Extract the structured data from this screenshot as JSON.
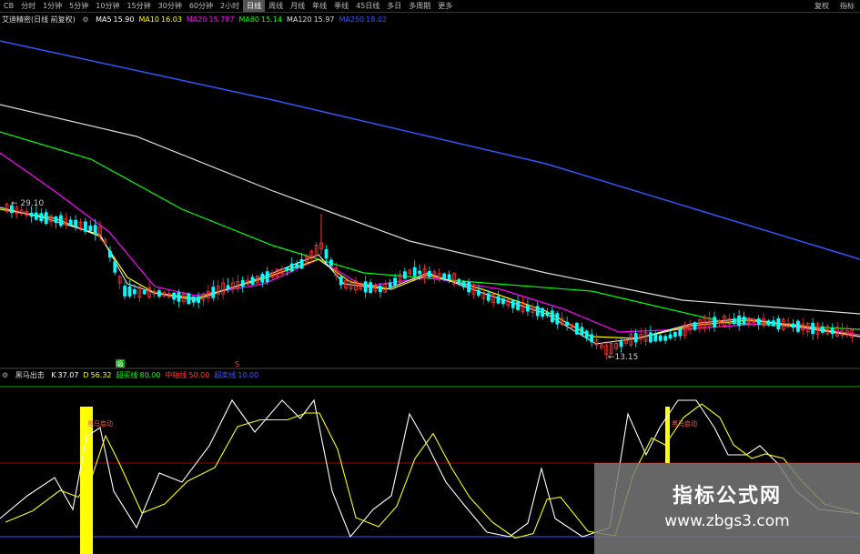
{
  "toolbar": {
    "items": [
      "CB",
      "分时",
      "1分钟",
      "5分钟",
      "10分钟",
      "15分钟",
      "30分钟",
      "60分钟",
      "2小时",
      "日线",
      "周线",
      "月线",
      "年线",
      "季线",
      "45日线",
      "多日",
      "多周期",
      "更多"
    ],
    "active_index": 9,
    "right_items": [
      "复权",
      "指标"
    ]
  },
  "main_legend": {
    "title": "艾迪精密(日线 前复权)",
    "items": [
      {
        "label": "MA5",
        "value": "15.90",
        "color": "#ffffff"
      },
      {
        "label": "MA10",
        "value": "16.03",
        "color": "#ffff00"
      },
      {
        "label": "MA20",
        "value": "15.787",
        "color": "#ff00ff"
      },
      {
        "label": "MA60",
        "value": "15.14",
        "color": "#00ff00"
      },
      {
        "label": "MA120",
        "value": "15.97",
        "color": "#dddddd"
      },
      {
        "label": "MA250",
        "value": "18.02",
        "color": "#3355ff"
      }
    ]
  },
  "price_labels": {
    "high": "29.10",
    "low": "13.15"
  },
  "signals": {
    "buy": "吸",
    "sell": "S"
  },
  "indicator_legend": {
    "title": "黑马出击",
    "items": [
      {
        "label": "K",
        "value": "37.07",
        "color": "#ffffff"
      },
      {
        "label": "D",
        "value": "56.32",
        "color": "#ffff00"
      },
      {
        "label": "超买线",
        "value": "80.00",
        "color": "#00ff00"
      },
      {
        "label": "中轴线",
        "value": "50.00",
        "color": "#ff3333"
      },
      {
        "label": "超卖线",
        "value": "10.00",
        "color": "#3355ff"
      }
    ]
  },
  "indicator_annotation": "黑马启动",
  "watermark": {
    "title": "指标公式网",
    "url": "www.zbgs3.com"
  },
  "colors": {
    "up": "#ff3333",
    "down": "#00ffff",
    "ma5": "#ffffff",
    "ma10": "#ffff00",
    "ma20": "#ff00ff",
    "ma60": "#00ff00",
    "ma120": "#dddddd",
    "ma250": "#3355ff"
  }
}
